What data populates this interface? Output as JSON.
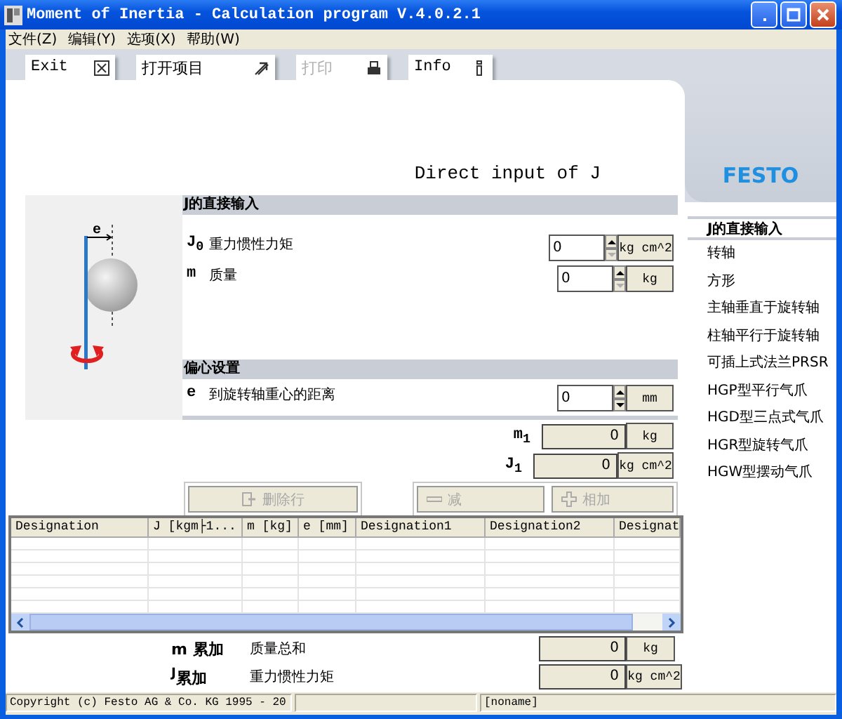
{
  "window": {
    "title": "Moment of Inertia - Calculation program V.4.0.2.1"
  },
  "menu": [
    "文件(Z)",
    "编辑(Y)",
    "选项(X)",
    "帮助(W)"
  ],
  "toolbar": [
    {
      "label": "Exit",
      "disabled": false
    },
    {
      "label": "打开项目",
      "disabled": false
    },
    {
      "label": "打印",
      "disabled": true
    },
    {
      "label": "Info",
      "disabled": false
    }
  ],
  "page_title": "Direct input of J",
  "diagram": {
    "dimension_label": "e"
  },
  "sections": [
    {
      "title": "J的直接输入",
      "rows": [
        {
          "symbol": "J$_{0}$",
          "label": "重力惯性力矩",
          "value": "0",
          "unit": "kg cm^2",
          "can_decrease": false
        },
        {
          "symbol": "m",
          "label": "质量",
          "value": "0",
          "unit": "kg",
          "can_decrease": false
        }
      ]
    },
    {
      "title": "偏心设置",
      "rows": [
        {
          "symbol": "e",
          "label": "到旋转轴重心的距离",
          "value": "0",
          "unit": "mm",
          "can_decrease": true
        }
      ]
    }
  ],
  "results": [
    {
      "symbol": "m$_{1}$",
      "value": "0",
      "unit": "kg"
    },
    {
      "symbol": "J$_{1}$",
      "value": "0",
      "unit": "kg cm^2"
    }
  ],
  "action_groups": [
    [
      {
        "label": "删除行",
        "disabled": true
      }
    ],
    [
      {
        "label": "减",
        "disabled": true
      },
      {
        "label": "相加",
        "disabled": true
      }
    ]
  ],
  "table": {
    "columns": [
      "Designation",
      "J [kgm├1...",
      "m [kg]",
      "e [mm]",
      "Designation1",
      "Designation2",
      "Designat"
    ]
  },
  "totals": [
    {
      "symbol": "m 累加",
      "label": "质量总和",
      "value": "0",
      "unit": "kg"
    },
    {
      "symbol": "$^{J}$累加",
      "label": "重力惯性力矩",
      "value": "0",
      "unit": "kg cm^2"
    }
  ],
  "sidebar": {
    "logo": "FESTO",
    "items": [
      {
        "label": "J的直接输入",
        "selected": true
      },
      {
        "label": "转轴",
        "selected": false
      },
      {
        "label": "方形",
        "selected": false
      },
      {
        "label": "主轴垂直于旋转轴",
        "selected": false
      },
      {
        "label": "柱轴平行于旋转轴",
        "selected": false
      },
      {
        "label": "可插上式法兰PRSR",
        "selected": false
      },
      {
        "label": "HGP型平行气爪",
        "selected": false
      },
      {
        "label": "HGD型三点式气爪",
        "selected": false
      },
      {
        "label": "HGR型旋转气爪",
        "selected": false
      },
      {
        "label": "HGW型摆动气爪",
        "selected": false
      }
    ]
  },
  "status_bar": {
    "copyright": "Copyright (c) Festo AG & Co. KG 1995 - 20",
    "file": "[noname]"
  }
}
